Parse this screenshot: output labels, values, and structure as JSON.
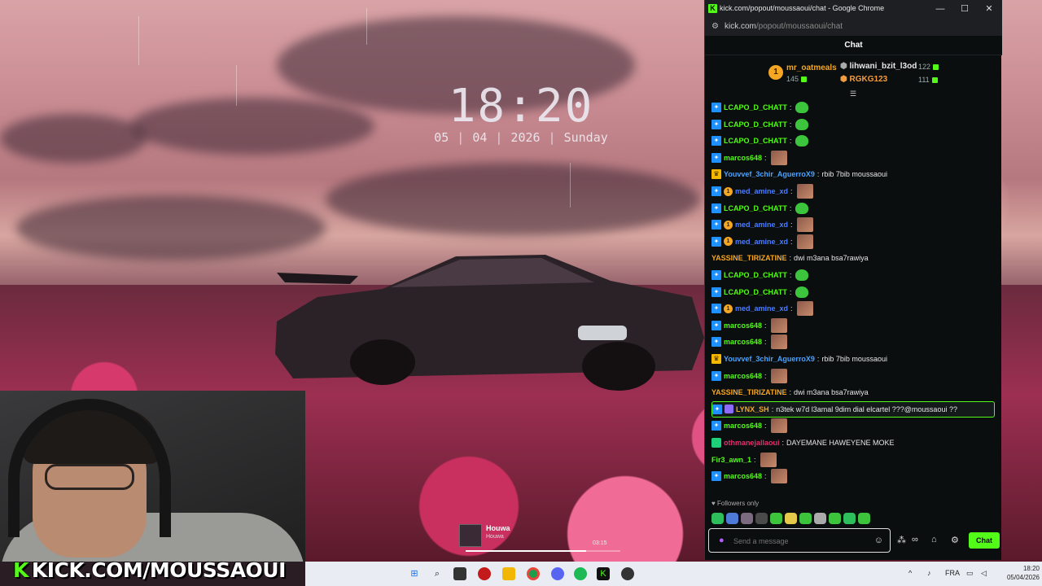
{
  "desktop": {
    "clock": {
      "time": "18:20",
      "day": "05",
      "month": "04",
      "year": "2026",
      "weekday": "Sunday",
      "separator": "|"
    },
    "media": {
      "title": "Houwa",
      "artist": "Houwa",
      "time": "03:15",
      "progress": 0.78
    },
    "overlay": {
      "k": "K",
      "text": "KICK.COM/MOUSSAOUI"
    }
  },
  "browser": {
    "window_title": "kick.com/popout/moussaoui/chat - Google Chrome",
    "url_host": "kick.com",
    "url_path": "/popout/moussaoui/chat",
    "controls": {
      "minimize": "—",
      "maximize": "☐",
      "close": "✕"
    }
  },
  "chat": {
    "header": "Chat",
    "leaderboard": [
      {
        "rank": "1",
        "name": "mr_oatmeals",
        "count": "145",
        "color": "#f5a623"
      },
      {
        "rank": "2",
        "name": "lihwani_bzit_l3od",
        "count": "122",
        "color": "#e8e8e8"
      },
      {
        "rank": "3",
        "name": "RGKG123",
        "count": "111",
        "color": "#f39c3f"
      }
    ],
    "messages": [
      {
        "badges": [
          "vip"
        ],
        "user": "LCAPO_D_CHATT",
        "color": "#53fc18",
        "text": "",
        "emote": "pepe"
      },
      {
        "badges": [
          "vip"
        ],
        "user": "LCAPO_D_CHATT",
        "color": "#53fc18",
        "text": "",
        "emote": "pepe"
      },
      {
        "badges": [
          "vip"
        ],
        "user": "LCAPO_D_CHATT",
        "color": "#53fc18",
        "text": "",
        "emote": "pepe"
      },
      {
        "badges": [
          "vip"
        ],
        "user": "marcos648",
        "color": "#53fc18",
        "text": "",
        "emote": "face"
      },
      {
        "badges": [
          "crown"
        ],
        "user": "Youvvef_3chir_AguerroX9",
        "color": "#4aa3ff",
        "text": "rbib 7bib moussaoui",
        "emote": ""
      },
      {
        "badges": [
          "vip",
          "num"
        ],
        "user": "med_amine_xd",
        "color": "#4a7dff",
        "text": "",
        "emote": "face"
      },
      {
        "badges": [
          "vip"
        ],
        "user": "LCAPO_D_CHATT",
        "color": "#53fc18",
        "text": "",
        "emote": "pepe"
      },
      {
        "badges": [
          "vip",
          "num"
        ],
        "user": "med_amine_xd",
        "color": "#4a7dff",
        "text": "",
        "emote": "face"
      },
      {
        "badges": [
          "vip",
          "num"
        ],
        "user": "med_amine_xd",
        "color": "#4a7dff",
        "text": "",
        "emote": "face"
      },
      {
        "badges": [],
        "user": "YASSINE_TIRIZATINE",
        "color": "#f5a623",
        "text": "dwi m3ana bsa7rawiya",
        "emote": ""
      },
      {
        "badges": [
          "vip"
        ],
        "user": "LCAPO_D_CHATT",
        "color": "#53fc18",
        "text": "",
        "emote": "pepe"
      },
      {
        "badges": [
          "vip"
        ],
        "user": "LCAPO_D_CHATT",
        "color": "#53fc18",
        "text": "",
        "emote": "pepe"
      },
      {
        "badges": [
          "vip",
          "num"
        ],
        "user": "med_amine_xd",
        "color": "#4a7dff",
        "text": "",
        "emote": "face"
      },
      {
        "badges": [
          "vip"
        ],
        "user": "marcos648",
        "color": "#53fc18",
        "text": "",
        "emote": "face"
      },
      {
        "badges": [
          "vip"
        ],
        "user": "marcos648",
        "color": "#53fc18",
        "text": "",
        "emote": "face"
      },
      {
        "badges": [
          "crown"
        ],
        "user": "Youvvef_3chir_AguerroX9",
        "color": "#4aa3ff",
        "text": "rbib 7bib moussaoui",
        "emote": ""
      },
      {
        "badges": [
          "vip"
        ],
        "user": "marcos648",
        "color": "#53fc18",
        "text": "",
        "emote": "face"
      },
      {
        "badges": [],
        "user": "YASSINE_TIRIZATINE",
        "color": "#f5a623",
        "text": "dwi m3ana bsa7rawiya",
        "emote": ""
      },
      {
        "badges": [
          "vip",
          "gift"
        ],
        "user": "LYNX_SH",
        "color": "#f5a623",
        "text": "n3tek w7d l3amal 9dim dial elcartel ???@moussaoui ??",
        "emote": "",
        "highlight": true
      },
      {
        "badges": [
          "vip"
        ],
        "user": "marcos648",
        "color": "#53fc18",
        "text": "",
        "emote": "face"
      },
      {
        "badges": [
          "green"
        ],
        "user": "othmanejallaoui",
        "color": "#e0306a",
        "text": "DAYEMANE HAWEYENE MOKE",
        "emote": ""
      },
      {
        "badges": [],
        "user": "Fir3_awn_1",
        "color": "#53fc18",
        "text": "",
        "emote": "face"
      },
      {
        "badges": [
          "vip"
        ],
        "user": "marcos648",
        "color": "#53fc18",
        "text": "",
        "emote": "face"
      }
    ],
    "followers_only": "Followers only",
    "input_placeholder": "Send a message",
    "send_label": "Chat"
  },
  "taskbar": {
    "language": "FRA",
    "time": "18:20",
    "date": "05/04/2026"
  },
  "colors": {
    "kick_green": "#53fc18",
    "panel_bg": "#0b0e0f"
  }
}
